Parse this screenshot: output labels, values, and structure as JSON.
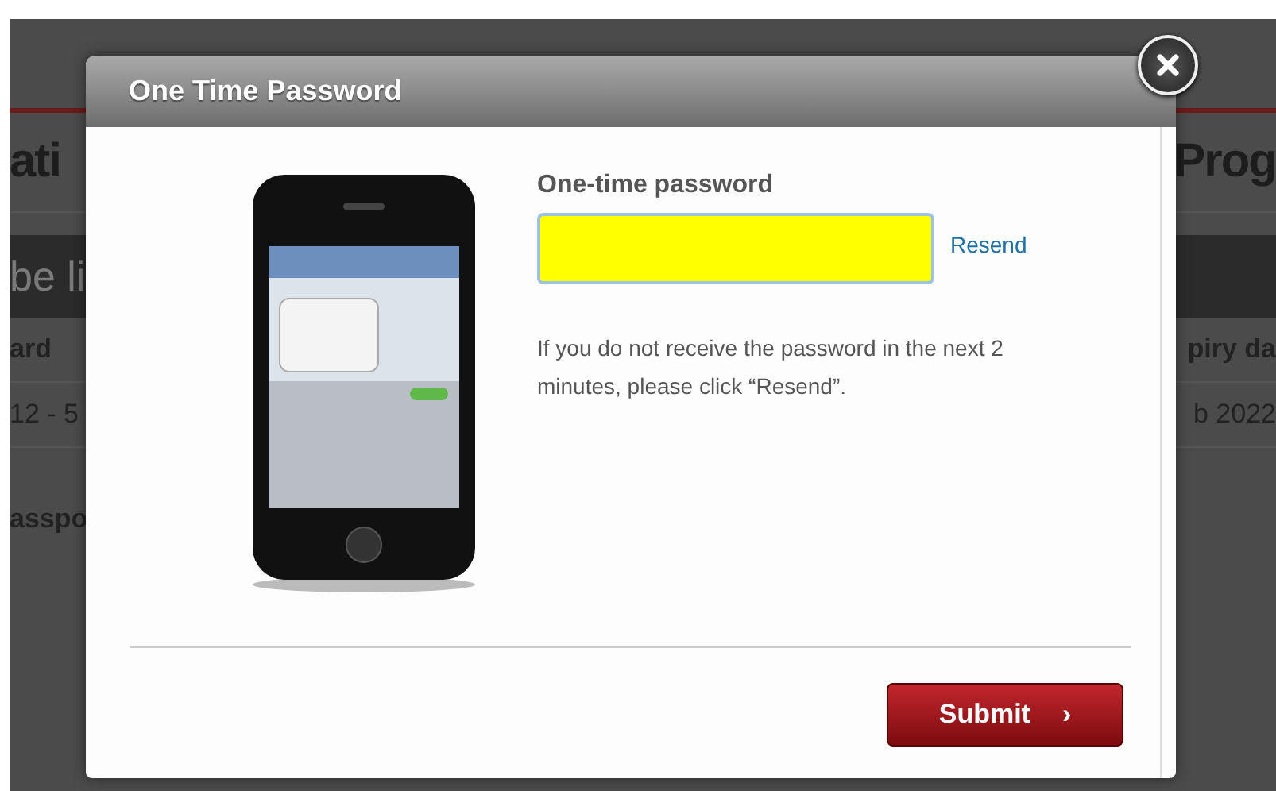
{
  "background_page": {
    "title_left": "ati",
    "title_right": "Prog",
    "band_left": "be li",
    "rows": [
      {
        "left": "ard",
        "right": "piry da"
      },
      {
        "left": "12 - 5",
        "right": "b 2022"
      },
      {
        "left": "asspo",
        "right": ""
      }
    ]
  },
  "dialog": {
    "title": "One Time Password",
    "field_label": "One-time password",
    "resend_link": "Resend",
    "help_text": "If you do not receive the password in the next 2 minutes, please click “Resend”.",
    "submit_button": "Submit",
    "submit_icon": "›"
  }
}
